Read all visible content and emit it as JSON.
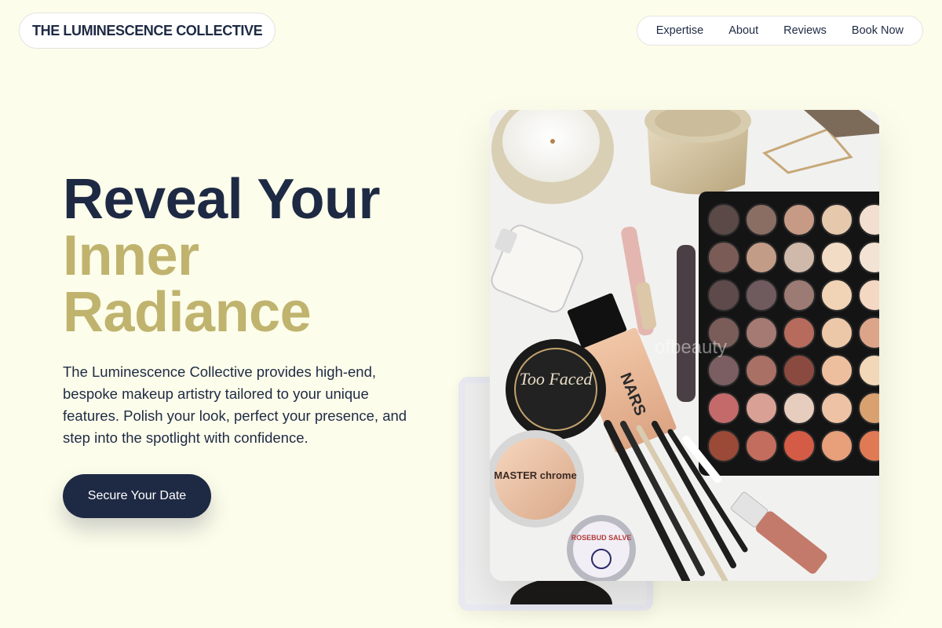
{
  "header": {
    "brand": "THE LUMINESCENCE COLLECTIVE",
    "nav": [
      "Expertise",
      "About",
      "Reviews",
      "Book Now"
    ]
  },
  "hero": {
    "title_line1": "Reveal Your",
    "title_line2": "Inner",
    "title_line3": "Radiance",
    "description": "The Luminescence Collective provides high-end, bespoke makeup artistry tailored to your unique features. Polish your look, perfect your presence, and step into the spotlight with confidence.",
    "cta_label": "Secure Your Date"
  },
  "product_labels": {
    "compact_brand": "Too Faced",
    "foundation_brand": "NARS",
    "highlighter": "MASTER chrome",
    "salve": "ROSEBUD SALVE",
    "watermark": "ofbeauty"
  },
  "colors": {
    "background": "#fdfdeb",
    "navy": "#1e2a44",
    "gold": "#bfb36e"
  }
}
